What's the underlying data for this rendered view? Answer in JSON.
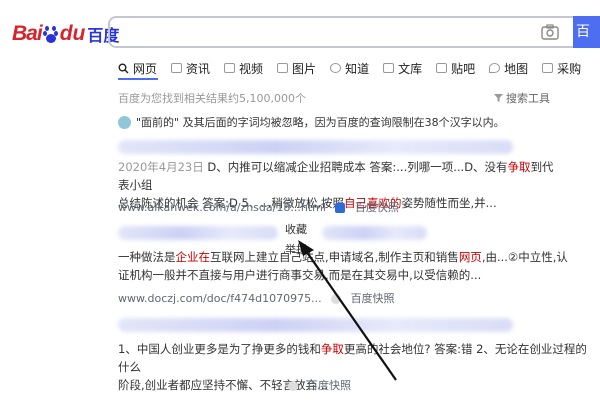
{
  "logo": {
    "text_bai": "Bai",
    "text_du": "du",
    "text_cn": "百度"
  },
  "search": {
    "value": "",
    "button_label": "百"
  },
  "tabs": [
    {
      "label": "网页",
      "icon": "search-icon"
    },
    {
      "label": "资讯",
      "icon": "news-icon"
    },
    {
      "label": "视频",
      "icon": "video-icon"
    },
    {
      "label": "图片",
      "icon": "image-icon"
    },
    {
      "label": "知道",
      "icon": "zhidao-icon"
    },
    {
      "label": "文库",
      "icon": "wenku-icon"
    },
    {
      "label": "贴吧",
      "icon": "tieba-icon"
    },
    {
      "label": "地图",
      "icon": "map-icon"
    },
    {
      "label": "采购",
      "icon": "purchase-icon"
    }
  ],
  "stats": "百度为您找到相关结果约5,100,000个",
  "tools": "搜索工具",
  "notice": "\"面前的\" 及其后面的字词均被忽略，因为百度的查询限制在38个汉字以内。",
  "result1": {
    "date": "2020年4月23日",
    "p1": " D、内推可以缩减企业招聘成本 答案:",
    "p2": "...列哪一项...D、没有",
    "red1": "争取",
    "p3": "到代表小组",
    "p4": "总结陈述的机会 答案:D 5、...稍微放松,按照",
    "red2": "自己喜欢的",
    "p5": "姿势随性而坐,并...",
    "url": "www.aikanwek.com/a/zhsda/18...html",
    "snapshot": "百度快照"
  },
  "menu": {
    "item1": "收藏",
    "item2": "举报"
  },
  "result2": {
    "p1": "一种做法是",
    "red1": "企业在",
    "p2": "互联网上建立自己",
    "p3": "站点,申请域名,制作主页和销售",
    "red2": "网页",
    "p4": ",由...②中立性,认",
    "p5": "证机构一般并不直接与用户进行商事交易,而是在其交易中,以受信赖的...",
    "url": "www.doczj.com/doc/f474d1070975...",
    "snapshot": "百度快照"
  },
  "result3": {
    "p1": "1、中国人创业更多是为了挣更多的钱和",
    "red1": "争取",
    "p2": "更高的社会地位? 答案:错 2、无论在创业过程的什么",
    "p3": "阶段,创业者都应坚持不懈、不轻言放弃...",
    "snapshot": "百度快照"
  }
}
